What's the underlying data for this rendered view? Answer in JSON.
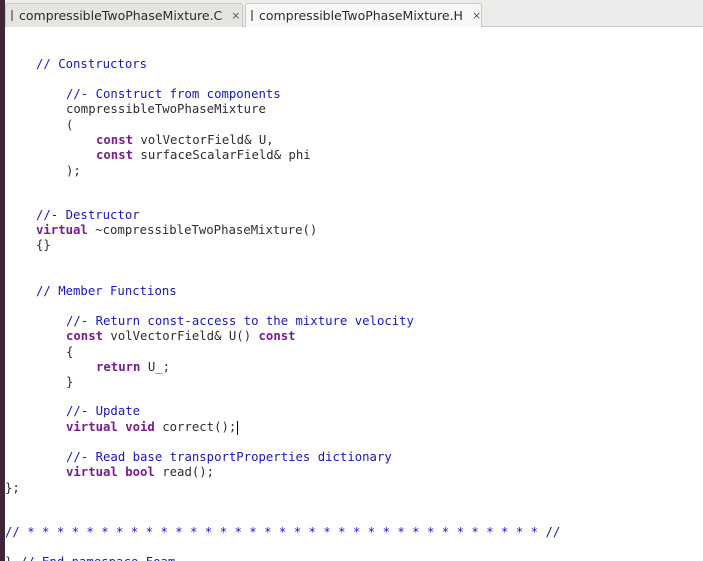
{
  "tabs": [
    {
      "label": "compressibleTwoPhaseMixture.C",
      "close": "×",
      "icon": "file-icon",
      "active": false
    },
    {
      "label": "compressibleTwoPhaseMixture.H",
      "close": "×",
      "icon": "file-icon",
      "active": true
    }
  ],
  "code": {
    "cut_line": "~ ...",
    "l01": "// Constructors",
    "l02": "//- Construct from components",
    "l03": "compressibleTwoPhaseMixture",
    "l04": "(",
    "l05_kw": "const",
    "l05_rest": " volVectorField& U,",
    "l06_kw": "const",
    "l06_rest": " surfaceScalarField& phi",
    "l07": ");",
    "l08": "//- Destructor",
    "l09_kw": "virtual",
    "l09_rest": " ~compressibleTwoPhaseMixture()",
    "l10": "{}",
    "l11": "// Member Functions",
    "l12": "//- Return const-access to the mixture velocity",
    "l13_kw1": "const",
    "l13_mid": " volVectorField& U() ",
    "l13_kw2": "const",
    "l14": "{",
    "l15_kw": "return",
    "l15_rest": " U_;",
    "l16": "}",
    "l17": "//- Update",
    "l18_kw": "virtual void",
    "l18_rest": " correct();",
    "l19": "//- Read base transportProperties dictionary",
    "l20_kw": "virtual bool",
    "l20_rest": " read();",
    "l21": "};",
    "l22": "// * * * * * * * * * * * * * * * * * * * * * * * * * * * * * * * * * * * //",
    "l23": "} // End namespace Foam"
  }
}
